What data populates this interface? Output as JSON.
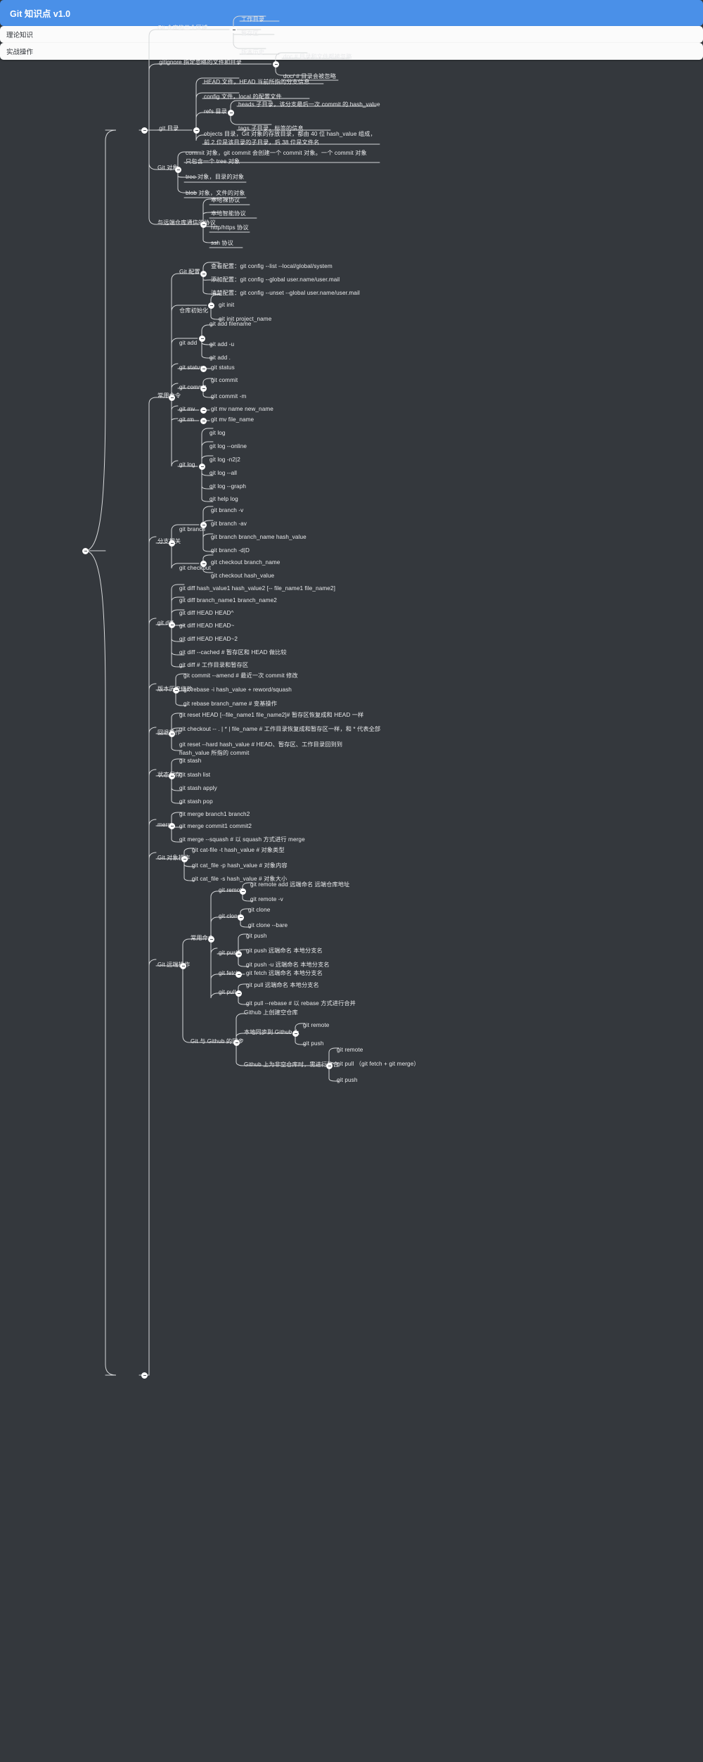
{
  "title": "Git 知识点 v1.0",
  "theme": {
    "background": "#34383d",
    "root_accent": "#4a90e8",
    "branch_pill": "#fbfbfb",
    "text": "#e9eaec",
    "line": "#d6d8da"
  },
  "root": {
    "label": "Git 知识点 v1.0"
  },
  "branches": [
    {
      "id": "theory",
      "label": "理论知识"
    },
    {
      "id": "practice",
      "label": "实战操作"
    }
  ],
  "theory": {
    "areas": {
      "label": "Git 仓库的三个区域",
      "items": [
        "工作目录",
        "暂存区",
        "版本历史"
      ]
    },
    "gitignore": {
      "label": ".gitignore 指定忽略的文件和目录",
      "items": [
        "doc # 目录和文件都被忽略",
        "doc/ # 目录会被忽略"
      ]
    },
    "gitdir": {
      "label": ".git 目录",
      "items": [
        {
          "label": "HEAD 文件，HEAD 当前所指的分支信息"
        },
        {
          "label": "config 文件，local 的配置文件"
        },
        {
          "label": "refs 目录",
          "children": [
            "heads 子目录，该分支最后一次 commit 的 hash_value",
            "tags 子目录，标签的信息"
          ]
        },
        {
          "label": "objects 目录，Git 对象的存放目录，都由 40 位 hash_value 组成，前 2 位是该目录的子目录，后 38 位是文件名"
        }
      ]
    },
    "gitobjects": {
      "label": "Git 对象",
      "items": [
        "commit 对象，git commit 会创建一个 commit 对象。一个 commit 对象只包含一个 tree 对象",
        "tree 对象，目录的对象",
        "blob 对象，文件的对象"
      ]
    },
    "protocols": {
      "label": "与远端仓库通信的协议",
      "items": [
        "本地裸协议",
        "本地智能协议",
        "http/https 协议",
        "ssh 协议"
      ]
    }
  },
  "practice": {
    "common": {
      "label": "常用命令",
      "groups": [
        {
          "label": "Git 配置",
          "items": [
            "查看配置：git config --list --local/global/system",
            "添加配置：git config --global user.name/user.mail",
            "清楚配置：git config --unset --global user.name/user.mail"
          ]
        },
        {
          "label": "仓库初始化",
          "items": [
            "git init",
            "git init project_name"
          ]
        },
        {
          "label": "git add",
          "items": [
            "git add filename",
            "git add -u",
            "git add ."
          ]
        },
        {
          "label": "git status",
          "items": [
            "git status"
          ]
        },
        {
          "label": "git commit",
          "items": [
            "git commit",
            "git commit -m"
          ]
        },
        {
          "label": "git mv",
          "items": [
            "git mv name  new_name"
          ]
        },
        {
          "label": "git rm",
          "items": [
            "git mv file_name"
          ]
        },
        {
          "label": "git log",
          "items": [
            "git log",
            "git log --online",
            "git log -n2|2",
            "git log --all",
            "git log --graph",
            "git help log"
          ]
        }
      ]
    },
    "branch": {
      "label": "分支相关",
      "groups": [
        {
          "label": "git branch",
          "items": [
            "git branch -v",
            "git branch -av",
            "git branch branch_name hash_value",
            "git branch -d|D"
          ]
        },
        {
          "label": "git checkout",
          "items": [
            "git checkout branch_name",
            "git checkout hash_value"
          ]
        }
      ]
    },
    "diff": {
      "label": "git diff",
      "items": [
        "git diff hash_value1 hash_value2 [-- file_name1 file_name2]",
        "git diff branch_name1 branch_name2",
        "git diff HEAD HEAD^",
        "git diff HEAD HEAD~",
        "git diff HEAD HEAD~2",
        "git diff --cached # 暂存区和 HEAD 做比较",
        "git diff # 工作目录和暂存区"
      ]
    },
    "history": {
      "label": "版本历史修改",
      "items": [
        "git commit --amend # 最近一次 commit 修改",
        "git rebase -i hash_value + reword/squash",
        "git rebase branch_name # 变基操作"
      ]
    },
    "rollback": {
      "label": "回退操作",
      "items": [
        "git reset HEAD [--file_name1 file_name2]# 暂存区恢复成和 HEAD 一样",
        "git checkout --  . | * | file_name  # 工作目录恢复成和暂存区一样，和 * 代表全部",
        "git reset --hard hash_value # HEAD、暂存区、工作目录回到到 hash_value 所指的 commit"
      ]
    },
    "stash": {
      "label": "状态保存",
      "items": [
        "git stash",
        "git stash list",
        "git stash apply",
        "git stash pop"
      ]
    },
    "merge": {
      "label": "merge",
      "items": [
        "git merge branch1 branch2",
        "git merge commit1 commit2",
        "git merge --squash # 以 squash 方式进行 merge"
      ]
    },
    "objectops": {
      "label": "Git 对象操作",
      "items": [
        "git cat-file -t hash_value # 对象类型",
        "git cat_file -p hash_value # 对象内容",
        "git cat_file -s hash_value # 对象大小"
      ]
    },
    "remote": {
      "label": "Git 远端操作",
      "groups": [
        {
          "label": "常用命令",
          "children": [
            {
              "label": "git remote",
              "items": [
                "git remote add 远端命名 远端仓库地址",
                "git remote -v"
              ]
            },
            {
              "label": "git clone",
              "items": [
                "git clone",
                "git clone --bare"
              ]
            },
            {
              "label": "git push",
              "items": [
                "git push",
                "git push 远端命名 本地分支名",
                "git push -u 远端命名 本地分支名"
              ]
            },
            {
              "label": "git fetch",
              "items": [
                "git fetch 远端命名 本地分支名"
              ]
            },
            {
              "label": "git pull",
              "items": [
                "git pull 远端命名 本地分支名",
                "git pull --rebase # 以 rebase 方式进行合并"
              ]
            }
          ]
        },
        {
          "label": "Git 与 Github 的同步",
          "children": [
            {
              "label": "Github 上创建空仓库",
              "items": []
            },
            {
              "label": "本地同步到 Github 上",
              "items": [
                "git remote",
                "git push"
              ]
            },
            {
              "label": "Github 上为非空仓库时，需进行整合",
              "items": [
                "git remote",
                "git pull （git fetch + git merge）",
                "git push"
              ]
            }
          ]
        }
      ]
    }
  }
}
